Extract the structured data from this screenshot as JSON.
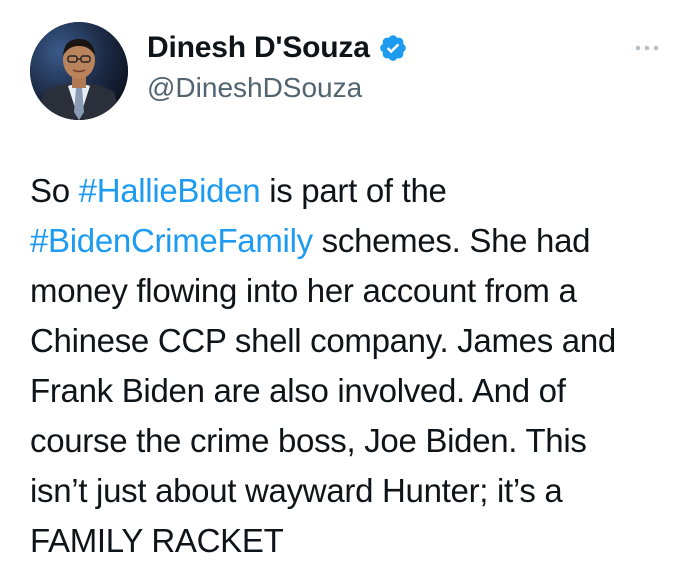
{
  "author": {
    "display_name": "Dinesh D'Souza",
    "handle": "@DineshDSouza",
    "verified_icon": "verified-badge-icon",
    "avatar_icon": "profile-photo"
  },
  "menu": {
    "more_icon": "more-options-icon"
  },
  "tweet": {
    "lines": [
      {
        "pre": "So ",
        "tag": "#HallieBiden",
        "post": " is part of the"
      },
      {
        "pre": "",
        "tag": "#BidenCrimeFamily",
        "post": " schemes. She had"
      },
      {
        "pre": "money flowing into her account from a",
        "tag": "",
        "post": ""
      },
      {
        "pre": "Chinese CCP shell company. James and",
        "tag": "",
        "post": ""
      },
      {
        "pre": "Frank Biden are also involved. And of",
        "tag": "",
        "post": ""
      },
      {
        "pre": "course the crime boss, Joe Biden. This",
        "tag": "",
        "post": ""
      },
      {
        "pre": "isn’t just about wayward Hunter; it’s a",
        "tag": "",
        "post": ""
      },
      {
        "pre": "FAMILY RACKET",
        "tag": "",
        "post": ""
      }
    ]
  },
  "colors": {
    "hashtag": "#1d9bf0",
    "verified": "#1d9bf0",
    "secondary_text": "#536471",
    "primary_text": "#0f1419"
  }
}
